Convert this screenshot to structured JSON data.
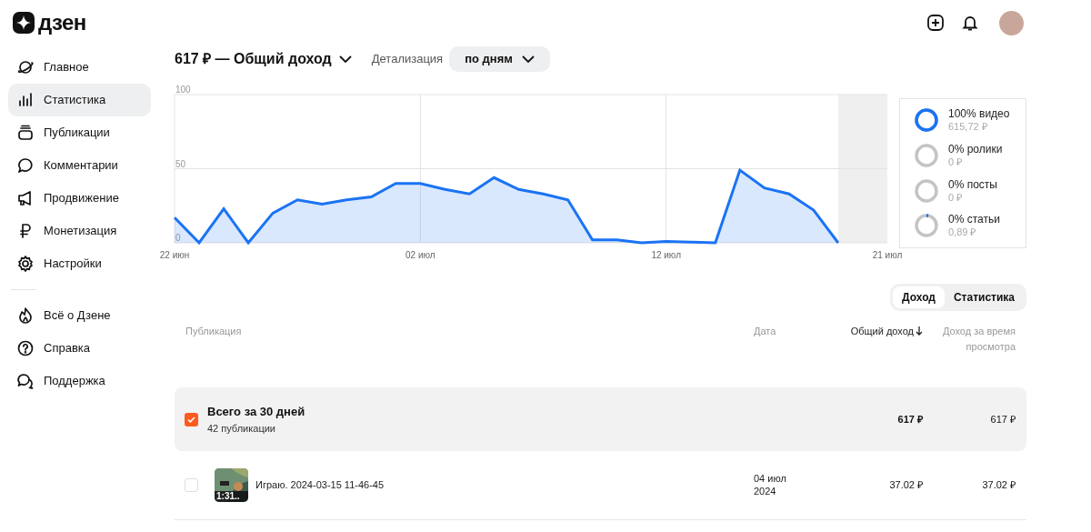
{
  "logo": {
    "text": "дзен"
  },
  "sidebar": {
    "items": [
      {
        "label": "Главное",
        "selected": false
      },
      {
        "label": "Статистика",
        "selected": true
      },
      {
        "label": "Публикации",
        "selected": false
      },
      {
        "label": "Комментарии",
        "selected": false
      },
      {
        "label": "Продвижение",
        "selected": false
      },
      {
        "label": "Монетизация",
        "selected": false
      },
      {
        "label": "Настройки",
        "selected": false
      }
    ],
    "secondary_items": [
      {
        "label": "Всё о Дзене"
      },
      {
        "label": "Справка"
      },
      {
        "label": "Поддержка"
      }
    ]
  },
  "header": {
    "metric": "617 ₽ — Общий доход",
    "detail_label": "Детализация",
    "detail_value": "по дням"
  },
  "chart_data": {
    "type": "area",
    "categories": [
      "22 июн",
      null,
      null,
      null,
      null,
      null,
      null,
      null,
      null,
      null,
      "02 июл",
      null,
      null,
      null,
      null,
      null,
      null,
      null,
      null,
      null,
      "12 июл",
      null,
      null,
      null,
      null,
      null,
      null,
      null,
      null,
      "21 июл"
    ],
    "series": [
      {
        "color": "#1a73f5",
        "values": [
          17,
          0,
          23,
          0,
          20,
          29,
          26,
          29,
          31,
          40,
          40,
          36,
          33,
          44,
          36,
          33,
          29,
          2,
          2,
          0,
          1,
          0.5,
          0,
          49,
          37,
          33,
          22,
          0,
          null,
          null
        ]
      }
    ],
    "ylim": [
      0,
      100
    ],
    "yticks": [
      0,
      50,
      100
    ],
    "grid": true
  },
  "breakdown": [
    {
      "label": "100% видео",
      "amount": "615,72 ₽",
      "level": 1
    },
    {
      "label": "0% ролики",
      "amount": "0 ₽",
      "level": 0
    },
    {
      "label": "0% посты",
      "amount": "0 ₽",
      "level": 0
    },
    {
      "label": "0% статьи",
      "amount": "0,89 ₽",
      "level": 0.03
    }
  ],
  "view_tabs": [
    {
      "label": "Доход",
      "selected": true
    },
    {
      "label": "Статистика",
      "selected": false
    }
  ],
  "table": {
    "columns": [
      "Публикация",
      "Дата",
      "Общий доход",
      "Доход за время просмотра"
    ],
    "summary": {
      "title": "Всего за 30 дней",
      "subtitle": "42 публикации",
      "checked": true,
      "total": "617 ₽",
      "watch": "617 ₽"
    },
    "rows": [
      {
        "title": "Играю. 2024-03-15 11-46-45",
        "duration": "1:31..",
        "date_line1": "04 июл",
        "date_line2": "2024",
        "total": "37.02 ₽",
        "watch": "37.02 ₽",
        "checked": false
      }
    ]
  }
}
